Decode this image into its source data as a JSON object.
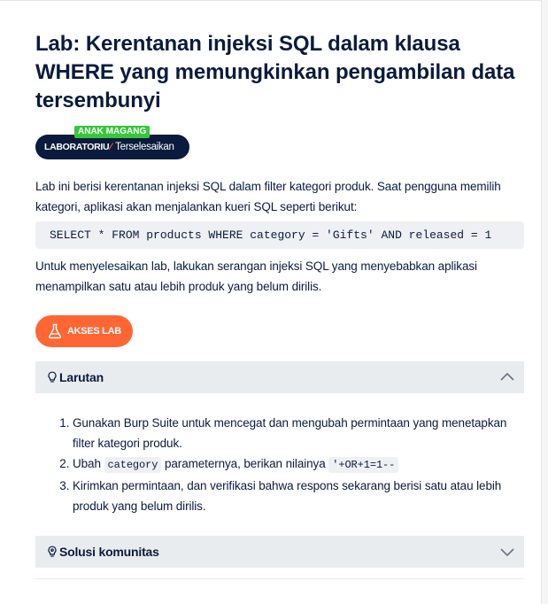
{
  "lab": {
    "title": "Lab: Kerentanan injeksi SQL dalam klausa WHERE yang memungkinkan pengambilan data tersembunyi",
    "level_tag": "ANAK MAGANG",
    "type_label": "LABORATORIU",
    "slash": "⁄",
    "status": "Terselesaikan",
    "description": "Lab ini berisi kerentanan injeksi SQL dalam filter kategori produk. Saat pengguna memilih kategori, aplikasi akan menjalankan kueri SQL seperti berikut:",
    "query": "SELECT * FROM products WHERE category = 'Gifts' AND released = 1",
    "goal": "Untuk menyelesaikan lab, lakukan serangan injeksi SQL yang menyebabkan aplikasi menampilkan satu atau lebih produk yang belum dirilis.",
    "access_button": "AKSES LAB"
  },
  "solution": {
    "title": "Larutan",
    "steps": {
      "s1": "Gunakan Burp Suite untuk mencegat dan mengubah permintaan yang menetapkan filter kategori produk.",
      "s2_pre": "Ubah ",
      "s2_code1": "category",
      "s2_mid": " parameternya, berikan nilainya ",
      "s2_code2": "'+OR+1=1--",
      "s3": "Kirimkan permintaan, dan verifikasi bahwa respons sekarang berisi satu atau lebih produk yang belum dirilis."
    }
  },
  "community": {
    "title": "Solusi komunitas"
  },
  "colors": {
    "navy": "#0a1b3d",
    "orange": "#ff6633",
    "green": "#37c73b",
    "panel": "#e9ecef"
  }
}
